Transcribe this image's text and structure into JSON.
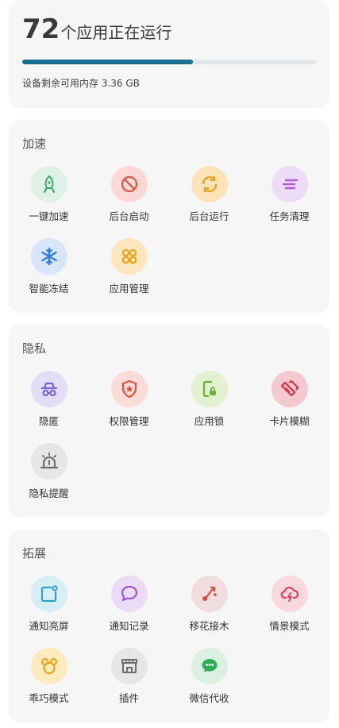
{
  "summary": {
    "app_count": "72",
    "running_text": "个应用正在运行",
    "memory_text": "设备剩余可用内存 3.36 GB",
    "memory_used_fraction": 0.58,
    "bar_color": "#1a6f8e"
  },
  "sections": [
    {
      "title": "加速",
      "items": [
        {
          "label": "一键加速",
          "icon": "rocket-icon",
          "bg": "#dff1e6",
          "fg": "#3aa56a"
        },
        {
          "label": "后台启动",
          "icon": "ban-icon",
          "bg": "#fbd9d6",
          "fg": "#e0533e"
        },
        {
          "label": "后台运行",
          "icon": "refresh-icon",
          "bg": "#fce3b8",
          "fg": "#f0a21b"
        },
        {
          "label": "任务清理",
          "icon": "clean-icon",
          "bg": "#ecdcf5",
          "fg": "#b25bd6"
        },
        {
          "label": "智能冻结",
          "icon": "snowflake-icon",
          "bg": "#d7e6fb",
          "fg": "#2f7ee6"
        },
        {
          "label": "应用管理",
          "icon": "apps-icon",
          "bg": "#fce6bd",
          "fg": "#f0a21b"
        }
      ]
    },
    {
      "title": "隐私",
      "items": [
        {
          "label": "隐匿",
          "icon": "incognito-icon",
          "bg": "#e3def7",
          "fg": "#7a5fd6"
        },
        {
          "label": "权限管理",
          "icon": "shield-icon",
          "bg": "#fcdcd8",
          "fg": "#e0533e"
        },
        {
          "label": "应用锁",
          "icon": "lock-icon",
          "bg": "#e2f1cf",
          "fg": "#6fb134"
        },
        {
          "label": "卡片模糊",
          "icon": "card-blur-icon",
          "bg": "#f4c9cf",
          "fg": "#d9304a"
        },
        {
          "label": "隐私提醒",
          "icon": "alarm-icon",
          "bg": "#e6e6e6",
          "fg": "#6e6e6e"
        }
      ]
    },
    {
      "title": "拓展",
      "items": [
        {
          "label": "通知亮屏",
          "icon": "notify-screen-icon",
          "bg": "#d8eef5",
          "fg": "#2fa0c6"
        },
        {
          "label": "通知记录",
          "icon": "chat-bubble-icon",
          "bg": "#eadcf7",
          "fg": "#9b56d6"
        },
        {
          "label": "移花接木",
          "icon": "graft-icon",
          "bg": "#f0dede",
          "fg": "#d94a3a"
        },
        {
          "label": "情景模式",
          "icon": "cloud-bolt-icon",
          "bg": "#f9d8df",
          "fg": "#e0405f"
        },
        {
          "label": "乖巧模式",
          "icon": "mouse-ears-icon",
          "bg": "#fcebbd",
          "fg": "#f0a21b"
        },
        {
          "label": "插件",
          "icon": "shop-icon",
          "bg": "#e6e6e6",
          "fg": "#6e6e6e"
        },
        {
          "label": "微信代收",
          "icon": "wechat-icon",
          "bg": "#dbf0e0",
          "fg": "#2fae55"
        }
      ]
    }
  ]
}
